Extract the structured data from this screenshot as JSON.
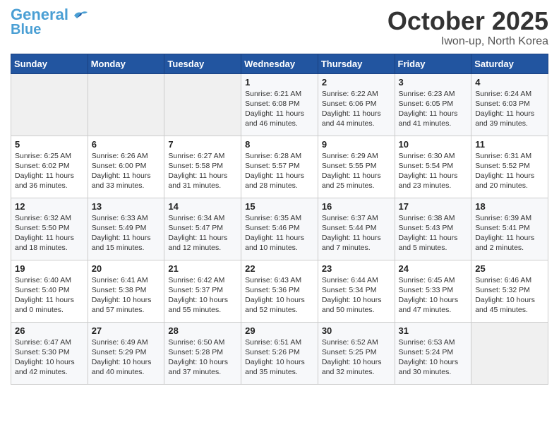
{
  "header": {
    "logo_line1": "General",
    "logo_line2": "Blue",
    "month": "October 2025",
    "location": "Iwon-up, North Korea"
  },
  "days_of_week": [
    "Sunday",
    "Monday",
    "Tuesday",
    "Wednesday",
    "Thursday",
    "Friday",
    "Saturday"
  ],
  "weeks": [
    [
      {
        "day": "",
        "empty": true
      },
      {
        "day": "",
        "empty": true
      },
      {
        "day": "",
        "empty": true
      },
      {
        "day": "1",
        "sunrise": "6:21 AM",
        "sunset": "6:08 PM",
        "daylight": "11 hours and 46 minutes."
      },
      {
        "day": "2",
        "sunrise": "6:22 AM",
        "sunset": "6:06 PM",
        "daylight": "11 hours and 44 minutes."
      },
      {
        "day": "3",
        "sunrise": "6:23 AM",
        "sunset": "6:05 PM",
        "daylight": "11 hours and 41 minutes."
      },
      {
        "day": "4",
        "sunrise": "6:24 AM",
        "sunset": "6:03 PM",
        "daylight": "11 hours and 39 minutes."
      }
    ],
    [
      {
        "day": "5",
        "sunrise": "6:25 AM",
        "sunset": "6:02 PM",
        "daylight": "11 hours and 36 minutes."
      },
      {
        "day": "6",
        "sunrise": "6:26 AM",
        "sunset": "6:00 PM",
        "daylight": "11 hours and 33 minutes."
      },
      {
        "day": "7",
        "sunrise": "6:27 AM",
        "sunset": "5:58 PM",
        "daylight": "11 hours and 31 minutes."
      },
      {
        "day": "8",
        "sunrise": "6:28 AM",
        "sunset": "5:57 PM",
        "daylight": "11 hours and 28 minutes."
      },
      {
        "day": "9",
        "sunrise": "6:29 AM",
        "sunset": "5:55 PM",
        "daylight": "11 hours and 25 minutes."
      },
      {
        "day": "10",
        "sunrise": "6:30 AM",
        "sunset": "5:54 PM",
        "daylight": "11 hours and 23 minutes."
      },
      {
        "day": "11",
        "sunrise": "6:31 AM",
        "sunset": "5:52 PM",
        "daylight": "11 hours and 20 minutes."
      }
    ],
    [
      {
        "day": "12",
        "sunrise": "6:32 AM",
        "sunset": "5:50 PM",
        "daylight": "11 hours and 18 minutes."
      },
      {
        "day": "13",
        "sunrise": "6:33 AM",
        "sunset": "5:49 PM",
        "daylight": "11 hours and 15 minutes."
      },
      {
        "day": "14",
        "sunrise": "6:34 AM",
        "sunset": "5:47 PM",
        "daylight": "11 hours and 12 minutes."
      },
      {
        "day": "15",
        "sunrise": "6:35 AM",
        "sunset": "5:46 PM",
        "daylight": "11 hours and 10 minutes."
      },
      {
        "day": "16",
        "sunrise": "6:37 AM",
        "sunset": "5:44 PM",
        "daylight": "11 hours and 7 minutes."
      },
      {
        "day": "17",
        "sunrise": "6:38 AM",
        "sunset": "5:43 PM",
        "daylight": "11 hours and 5 minutes."
      },
      {
        "day": "18",
        "sunrise": "6:39 AM",
        "sunset": "5:41 PM",
        "daylight": "11 hours and 2 minutes."
      }
    ],
    [
      {
        "day": "19",
        "sunrise": "6:40 AM",
        "sunset": "5:40 PM",
        "daylight": "11 hours and 0 minutes."
      },
      {
        "day": "20",
        "sunrise": "6:41 AM",
        "sunset": "5:38 PM",
        "daylight": "10 hours and 57 minutes."
      },
      {
        "day": "21",
        "sunrise": "6:42 AM",
        "sunset": "5:37 PM",
        "daylight": "10 hours and 55 minutes."
      },
      {
        "day": "22",
        "sunrise": "6:43 AM",
        "sunset": "5:36 PM",
        "daylight": "10 hours and 52 minutes."
      },
      {
        "day": "23",
        "sunrise": "6:44 AM",
        "sunset": "5:34 PM",
        "daylight": "10 hours and 50 minutes."
      },
      {
        "day": "24",
        "sunrise": "6:45 AM",
        "sunset": "5:33 PM",
        "daylight": "10 hours and 47 minutes."
      },
      {
        "day": "25",
        "sunrise": "6:46 AM",
        "sunset": "5:32 PM",
        "daylight": "10 hours and 45 minutes."
      }
    ],
    [
      {
        "day": "26",
        "sunrise": "6:47 AM",
        "sunset": "5:30 PM",
        "daylight": "10 hours and 42 minutes."
      },
      {
        "day": "27",
        "sunrise": "6:49 AM",
        "sunset": "5:29 PM",
        "daylight": "10 hours and 40 minutes."
      },
      {
        "day": "28",
        "sunrise": "6:50 AM",
        "sunset": "5:28 PM",
        "daylight": "10 hours and 37 minutes."
      },
      {
        "day": "29",
        "sunrise": "6:51 AM",
        "sunset": "5:26 PM",
        "daylight": "10 hours and 35 minutes."
      },
      {
        "day": "30",
        "sunrise": "6:52 AM",
        "sunset": "5:25 PM",
        "daylight": "10 hours and 32 minutes."
      },
      {
        "day": "31",
        "sunrise": "6:53 AM",
        "sunset": "5:24 PM",
        "daylight": "10 hours and 30 minutes."
      },
      {
        "day": "",
        "empty": true
      }
    ]
  ]
}
